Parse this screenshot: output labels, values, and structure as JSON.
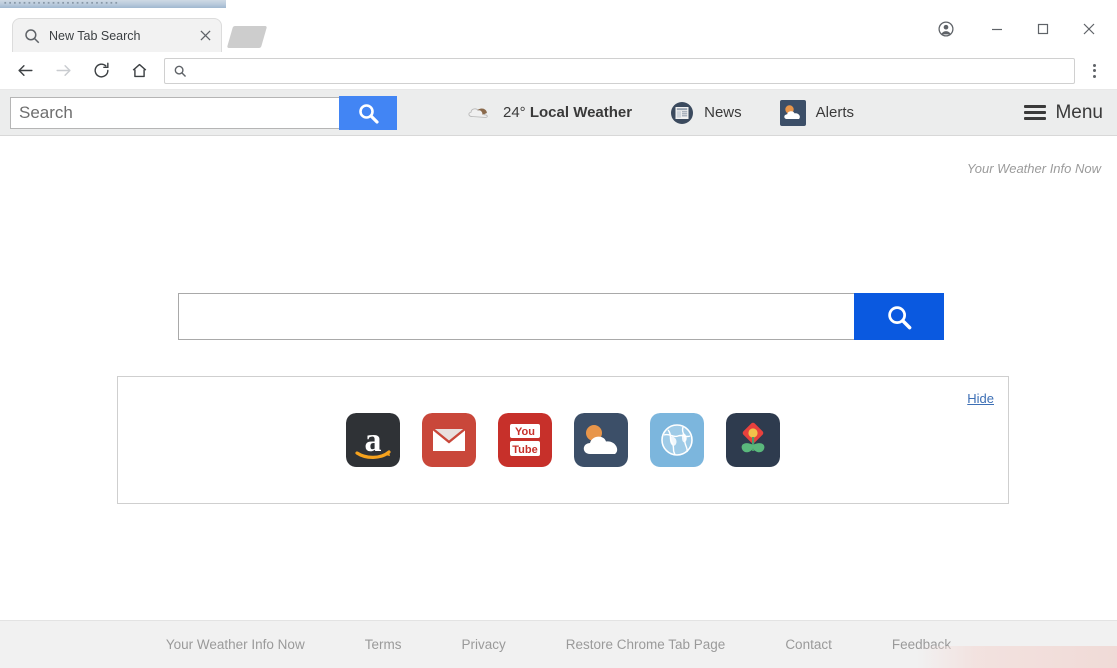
{
  "top_strip": {
    "text": "▪ ▪ ▪ ▪ ▪ ▪ ▪ ▪ ▪ ▪ ▪ ▪ ▪ ▪ ▪ ▪ ▪ ▪ ▪ ▪ ▪ ▪ ▪ ▪"
  },
  "browser": {
    "tab": {
      "title": "New Tab Search",
      "favicon_icon": "search-icon",
      "close_icon": "close-icon"
    },
    "new_tab_button_icon": "new-tab-icon",
    "window_controls": {
      "profile_icon": "profile-avatar-icon",
      "minimize_label": "–",
      "maximize_label": "□",
      "close_label": "✕"
    },
    "toolbar": {
      "back_icon": "back-arrow-icon",
      "forward_icon": "forward-arrow-icon",
      "reload_icon": "reload-icon",
      "home_icon": "home-icon",
      "omnibox_icon": "search-icon",
      "omnibox_value": "",
      "omnibox_placeholder": "",
      "menu_icon": "three-dot-menu-icon"
    }
  },
  "extension_bar": {
    "search_placeholder": "Search",
    "search_value": "",
    "search_button_icon": "search-icon",
    "items": [
      {
        "icon": "cloud-weather-icon",
        "temp": "24°",
        "label": "Local Weather"
      },
      {
        "icon": "newspaper-icon",
        "label": "News"
      },
      {
        "icon": "sun-cloud-alert-icon",
        "label": "Alerts"
      }
    ],
    "menu_label": "Menu",
    "menu_icon": "hamburger-icon"
  },
  "page": {
    "brand": "Your Weather Info Now",
    "search": {
      "value": "",
      "placeholder": "",
      "button_icon": "search-icon"
    },
    "tiles_panel": {
      "hide_label": "Hide",
      "tiles": [
        {
          "name": "amazon",
          "icon": "amazon-icon",
          "bg": "#2f3236"
        },
        {
          "name": "gmail",
          "icon": "gmail-icon",
          "bg": "#c9473a"
        },
        {
          "name": "youtube",
          "icon": "youtube-icon",
          "bg": "#c7302a"
        },
        {
          "name": "weather",
          "icon": "weather-icon",
          "bg": "#3c4f68"
        },
        {
          "name": "world",
          "icon": "globe-icon",
          "bg": "#7cb6dd"
        },
        {
          "name": "garden",
          "icon": "flower-icon",
          "bg": "#2e3b4e"
        }
      ]
    },
    "footer_links": [
      "Your Weather Info Now",
      "Terms",
      "Privacy",
      "Restore Chrome Tab Page",
      "Contact",
      "Feedback"
    ]
  },
  "colors": {
    "accent_blue": "#0a59e0",
    "ext_button_blue": "#4285f4",
    "link_blue": "#3d6fb5",
    "ext_bar_bg": "#eceded",
    "footer_bg": "#f1f1f1"
  }
}
